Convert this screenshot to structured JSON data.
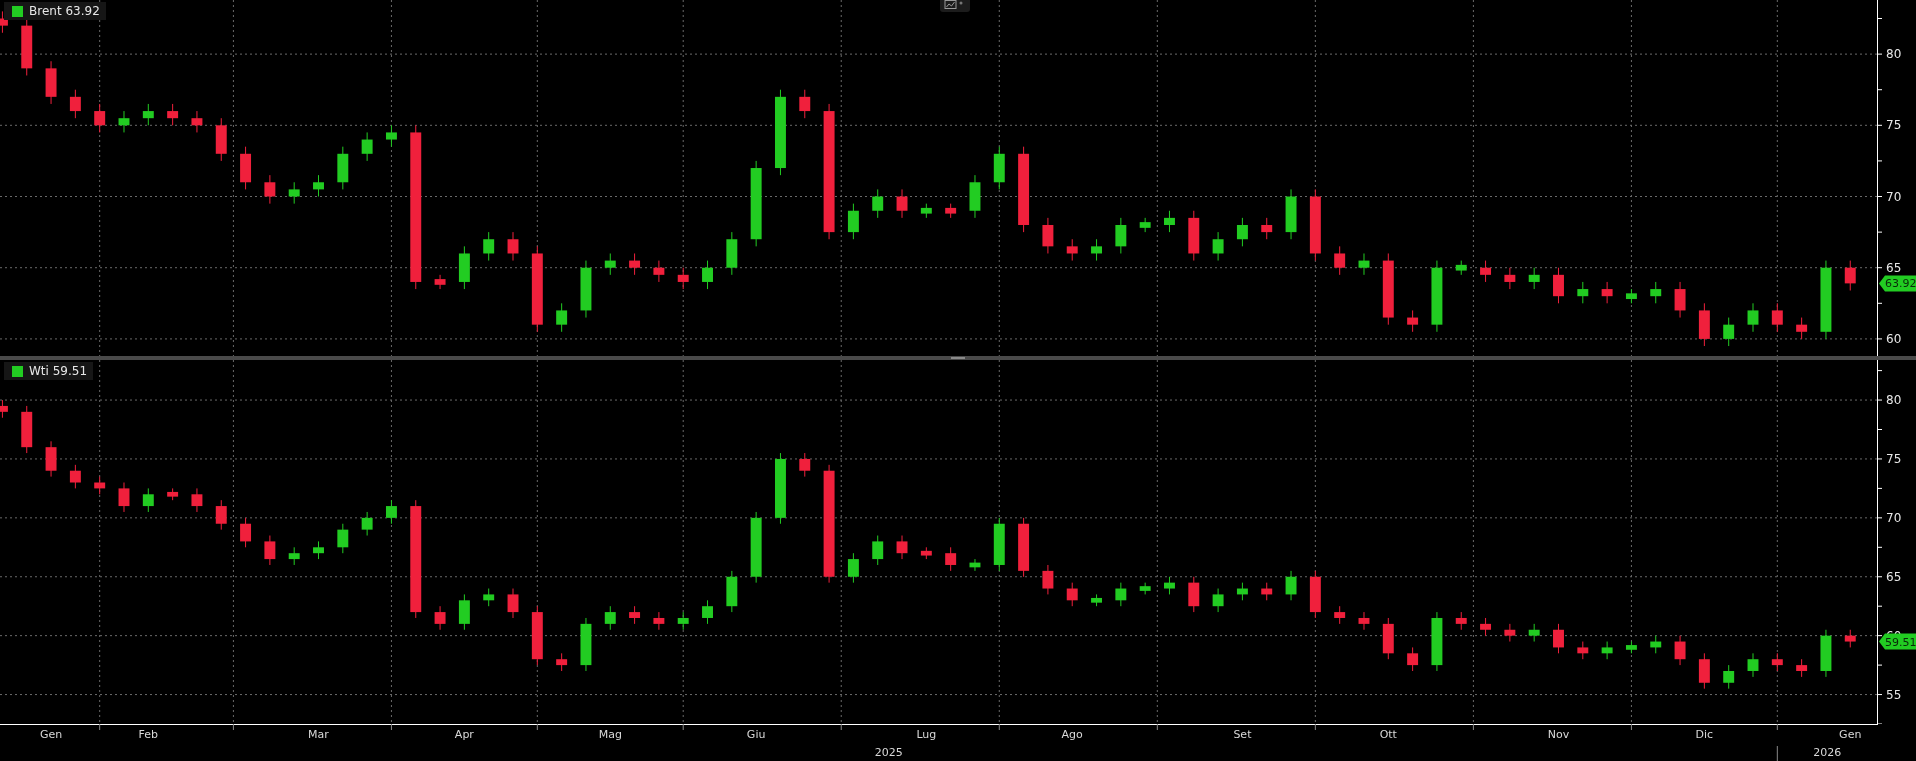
{
  "panels": [
    {
      "legend": {
        "name": "Brent",
        "color": "#22cc22"
      },
      "legend_value": "63.92",
      "price_tag": "63.92",
      "chart_data": {
        "type": "candlestick",
        "grid": true,
        "ylim": [
          58.8,
          83.8
        ],
        "yticks": [
          60,
          65,
          70,
          75,
          80
        ],
        "ohlc": [
          [
            82.5,
            83,
            81.5,
            82
          ],
          [
            82,
            82.5,
            78.5,
            79
          ],
          [
            79,
            79.5,
            76.5,
            77
          ],
          [
            77,
            77.5,
            75.5,
            76
          ],
          [
            76,
            76.5,
            74.5,
            75
          ],
          [
            75,
            76,
            74.5,
            75.5
          ],
          [
            75.5,
            76.5,
            75,
            76
          ],
          [
            76,
            76.5,
            75,
            75.5
          ],
          [
            75.5,
            76,
            74.5,
            75
          ],
          [
            75,
            75.5,
            72.5,
            73
          ],
          [
            73,
            73.5,
            70.5,
            71
          ],
          [
            71,
            71.5,
            69.5,
            70
          ],
          [
            70,
            71,
            69.5,
            70.5
          ],
          [
            70.5,
            71.5,
            70,
            71
          ],
          [
            71,
            73.5,
            70.5,
            73
          ],
          [
            73,
            74.5,
            72.5,
            74
          ],
          [
            74,
            75,
            73.5,
            74.5
          ],
          [
            74.5,
            75,
            63.5,
            64
          ],
          [
            64.2,
            64.5,
            63.5,
            63.8
          ],
          [
            64,
            66.5,
            63.5,
            66
          ],
          [
            66,
            67.5,
            65.5,
            67
          ],
          [
            67,
            67.5,
            65.5,
            66
          ],
          [
            66,
            66.5,
            60.5,
            61
          ],
          [
            61,
            62.5,
            60.5,
            62
          ],
          [
            62,
            65.5,
            61.5,
            65
          ],
          [
            65,
            66,
            64.5,
            65.5
          ],
          [
            65.5,
            66,
            64.5,
            65
          ],
          [
            65,
            65.5,
            64,
            64.5
          ],
          [
            64.5,
            65,
            63.5,
            64
          ],
          [
            64,
            65.5,
            63.5,
            65
          ],
          [
            65,
            67.5,
            64.5,
            67
          ],
          [
            67,
            72.5,
            66.5,
            72
          ],
          [
            72,
            77.5,
            71.5,
            77
          ],
          [
            77,
            77.5,
            75.5,
            76
          ],
          [
            76,
            76.5,
            67,
            67.5
          ],
          [
            67.5,
            69.5,
            67,
            69
          ],
          [
            69,
            70.5,
            68.5,
            70
          ],
          [
            70,
            70.5,
            68.5,
            69
          ],
          [
            68.8,
            69.5,
            68.5,
            69.2
          ],
          [
            69.2,
            69.5,
            68.5,
            68.8
          ],
          [
            69,
            71.5,
            68.5,
            71
          ],
          [
            71,
            73.5,
            70.5,
            73
          ],
          [
            73,
            73.5,
            67.5,
            68
          ],
          [
            68,
            68.5,
            66,
            66.5
          ],
          [
            66.5,
            67,
            65.5,
            66
          ],
          [
            66,
            67,
            65.5,
            66.5
          ],
          [
            66.5,
            68.5,
            66,
            68
          ],
          [
            67.8,
            68.5,
            67.5,
            68.2
          ],
          [
            68,
            69,
            67.5,
            68.5
          ],
          [
            68.5,
            69,
            65.5,
            66
          ],
          [
            66,
            67.5,
            65.5,
            67
          ],
          [
            67,
            68.5,
            66.5,
            68
          ],
          [
            68,
            68.5,
            67,
            67.5
          ],
          [
            67.5,
            70.5,
            67,
            70
          ],
          [
            70,
            70.5,
            65.5,
            66
          ],
          [
            66,
            66.5,
            64.5,
            65
          ],
          [
            65,
            66,
            64.5,
            65.5
          ],
          [
            65.5,
            66,
            61,
            61.5
          ],
          [
            61.5,
            62,
            60.5,
            61
          ],
          [
            61,
            65.5,
            60.5,
            65
          ],
          [
            64.8,
            65.5,
            64.5,
            65.2
          ],
          [
            65,
            65.5,
            64,
            64.5
          ],
          [
            64.5,
            65,
            63.5,
            64
          ],
          [
            64,
            65,
            63.5,
            64.5
          ],
          [
            64.5,
            65,
            62.5,
            63
          ],
          [
            63,
            64,
            62.5,
            63.5
          ],
          [
            63.5,
            64,
            62.5,
            63
          ],
          [
            62.8,
            63.5,
            62.5,
            63.2
          ],
          [
            63,
            64,
            62.5,
            63.5
          ],
          [
            63.5,
            64,
            61.5,
            62
          ],
          [
            62,
            62.5,
            59.5,
            60
          ],
          [
            60,
            61.5,
            59.5,
            61
          ],
          [
            61,
            62.5,
            60.5,
            62
          ],
          [
            62,
            62.5,
            60.5,
            61
          ],
          [
            61,
            61.5,
            60,
            60.5
          ],
          [
            60.5,
            65.5,
            60,
            65
          ],
          [
            65,
            65.5,
            63.4,
            63.9
          ]
        ]
      }
    },
    {
      "legend": {
        "name": "Wti",
        "color": "#22cc22"
      },
      "legend_value": "59.51",
      "price_tag": "59.51",
      "year_labels": [
        "2025",
        "2026"
      ],
      "chart_data": {
        "type": "candlestick",
        "grid": true,
        "ylim": [
          52.5,
          83.4
        ],
        "yticks": [
          55,
          60,
          65,
          70,
          75,
          80
        ],
        "categories": [
          null,
          null,
          "Gen",
          null,
          null,
          null,
          "Feb",
          null,
          null,
          null,
          null,
          null,
          null,
          "Mar",
          null,
          null,
          null,
          null,
          null,
          "Apr",
          null,
          null,
          null,
          null,
          null,
          "Mag",
          null,
          null,
          null,
          null,
          null,
          "Giu",
          null,
          null,
          null,
          null,
          null,
          null,
          "Lug",
          null,
          null,
          null,
          null,
          null,
          "Ago",
          null,
          null,
          null,
          null,
          null,
          null,
          "Set",
          null,
          null,
          null,
          null,
          null,
          "Ott",
          null,
          null,
          null,
          null,
          null,
          null,
          "Nov",
          null,
          null,
          null,
          null,
          null,
          "Dic",
          null,
          null,
          null,
          null,
          null,
          "Gen"
        ],
        "ohlc": [
          [
            79.5,
            80,
            78.5,
            79
          ],
          [
            79,
            79.5,
            75.5,
            76
          ],
          [
            76,
            76.5,
            73.5,
            74
          ],
          [
            74,
            74.5,
            72.5,
            73
          ],
          [
            73,
            73.5,
            72,
            72.5
          ],
          [
            72.5,
            73,
            70.5,
            71
          ],
          [
            71,
            72.5,
            70.5,
            72
          ],
          [
            72.2,
            72.5,
            71.5,
            71.8
          ],
          [
            72,
            72.5,
            70.5,
            71
          ],
          [
            71,
            71.5,
            69,
            69.5
          ],
          [
            69.5,
            70,
            67.5,
            68
          ],
          [
            68,
            68.5,
            66,
            66.5
          ],
          [
            66.5,
            67.5,
            66,
            67
          ],
          [
            67,
            68,
            66.5,
            67.5
          ],
          [
            67.5,
            69.5,
            67,
            69
          ],
          [
            69,
            70.5,
            68.5,
            70
          ],
          [
            70,
            71.5,
            69.5,
            71
          ],
          [
            71,
            71.5,
            61.5,
            62
          ],
          [
            62,
            62.5,
            60.5,
            61
          ],
          [
            61,
            63.5,
            60.5,
            63
          ],
          [
            63,
            64,
            62.5,
            63.5
          ],
          [
            63.5,
            64,
            61.5,
            62
          ],
          [
            62,
            62.5,
            57.5,
            58
          ],
          [
            58,
            58.5,
            57,
            57.5
          ],
          [
            57.5,
            61.5,
            57,
            61
          ],
          [
            61,
            62.5,
            60.5,
            62
          ],
          [
            62,
            62.5,
            61,
            61.5
          ],
          [
            61.5,
            62,
            60.5,
            61
          ],
          [
            61,
            62,
            60.5,
            61.5
          ],
          [
            61.5,
            63,
            61,
            62.5
          ],
          [
            62.5,
            65.5,
            62,
            65
          ],
          [
            65,
            70.5,
            64.5,
            70
          ],
          [
            70,
            75.5,
            69.5,
            75
          ],
          [
            75,
            75.5,
            73.5,
            74
          ],
          [
            74,
            74.5,
            64.5,
            65
          ],
          [
            65,
            67,
            64.5,
            66.5
          ],
          [
            66.5,
            68.5,
            66,
            68
          ],
          [
            68,
            68.5,
            66.5,
            67
          ],
          [
            67.2,
            67.5,
            66.5,
            66.8
          ],
          [
            67,
            67.5,
            65.5,
            66
          ],
          [
            65.8,
            66.5,
            65.5,
            66.2
          ],
          [
            66,
            70,
            65.5,
            69.5
          ],
          [
            69.5,
            70,
            65,
            65.5
          ],
          [
            65.5,
            66,
            63.5,
            64
          ],
          [
            64,
            64.5,
            62.5,
            63
          ],
          [
            62.8,
            63.5,
            62.5,
            63.2
          ],
          [
            63,
            64.5,
            62.5,
            64
          ],
          [
            63.8,
            64.5,
            63.5,
            64.2
          ],
          [
            64,
            65,
            63.5,
            64.5
          ],
          [
            64.5,
            65,
            62,
            62.5
          ],
          [
            62.5,
            64,
            62,
            63.5
          ],
          [
            63.5,
            64.5,
            63,
            64
          ],
          [
            64,
            64.5,
            63,
            63.5
          ],
          [
            63.5,
            65.5,
            63,
            65
          ],
          [
            65,
            65.5,
            61.5,
            62
          ],
          [
            62,
            62.5,
            61,
            61.5
          ],
          [
            61.5,
            62,
            60.5,
            61
          ],
          [
            61,
            61.5,
            58,
            58.5
          ],
          [
            58.5,
            59,
            57,
            57.5
          ],
          [
            57.5,
            62,
            57,
            61.5
          ],
          [
            61.5,
            62,
            60.5,
            61
          ],
          [
            61,
            61.5,
            60,
            60.5
          ],
          [
            60.5,
            61,
            59.5,
            60
          ],
          [
            60,
            61,
            59.5,
            60.5
          ],
          [
            60.5,
            61,
            58.5,
            59
          ],
          [
            59,
            59.5,
            58,
            58.5
          ],
          [
            58.5,
            59.5,
            58,
            59
          ],
          [
            58.8,
            59.5,
            58.5,
            59.2
          ],
          [
            59,
            60,
            58.5,
            59.5
          ],
          [
            59.5,
            60,
            57.5,
            58
          ],
          [
            58,
            58.5,
            55.5,
            56
          ],
          [
            56,
            57.5,
            55.5,
            57
          ],
          [
            57,
            58.5,
            56.5,
            58
          ],
          [
            58,
            58.5,
            57,
            57.5
          ],
          [
            57.5,
            58,
            56.5,
            57
          ],
          [
            57,
            60.5,
            56.5,
            60
          ],
          [
            60,
            60.5,
            59,
            59.5
          ]
        ]
      }
    }
  ]
}
